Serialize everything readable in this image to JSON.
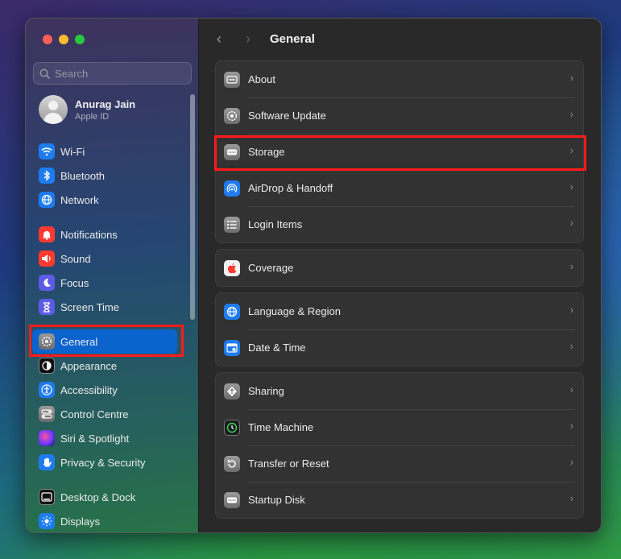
{
  "sidebar": {
    "search_placeholder": "Search",
    "profile": {
      "name": "Anurag Jain",
      "subtitle": "Apple ID"
    },
    "items": [
      {
        "label": "Wi-Fi",
        "icon": "wifi-icon"
      },
      {
        "label": "Bluetooth",
        "icon": "bluetooth-icon"
      },
      {
        "label": "Network",
        "icon": "globe-icon"
      },
      {
        "label": "Notifications",
        "icon": "bell-icon"
      },
      {
        "label": "Sound",
        "icon": "speaker-icon"
      },
      {
        "label": "Focus",
        "icon": "moon-icon"
      },
      {
        "label": "Screen Time",
        "icon": "hourglass-icon"
      },
      {
        "label": "General",
        "icon": "gear-icon",
        "selected": true
      },
      {
        "label": "Appearance",
        "icon": "appearance-icon"
      },
      {
        "label": "Accessibility",
        "icon": "accessibility-icon"
      },
      {
        "label": "Control Centre",
        "icon": "control-centre-icon"
      },
      {
        "label": "Siri & Spotlight",
        "icon": "siri-icon"
      },
      {
        "label": "Privacy & Security",
        "icon": "hand-icon"
      },
      {
        "label": "Desktop & Dock",
        "icon": "dock-icon"
      },
      {
        "label": "Displays",
        "icon": "sun-icon"
      }
    ]
  },
  "header": {
    "title": "General",
    "back": "‹",
    "forward": "›"
  },
  "groups": [
    {
      "rows": [
        {
          "label": "About",
          "icon": "about-icon"
        },
        {
          "label": "Software Update",
          "icon": "software-update-icon"
        },
        {
          "label": "Storage",
          "icon": "storage-icon"
        },
        {
          "label": "AirDrop & Handoff",
          "icon": "airdrop-icon"
        },
        {
          "label": "Login Items",
          "icon": "list-icon"
        }
      ]
    },
    {
      "rows": [
        {
          "label": "Coverage",
          "icon": "apple-icon"
        }
      ]
    },
    {
      "rows": [
        {
          "label": "Language & Region",
          "icon": "globe-icon"
        },
        {
          "label": "Date & Time",
          "icon": "calendar-icon"
        }
      ]
    },
    {
      "rows": [
        {
          "label": "Sharing",
          "icon": "sharing-icon"
        },
        {
          "label": "Time Machine",
          "icon": "time-machine-icon"
        },
        {
          "label": "Transfer or Reset",
          "icon": "reset-icon"
        },
        {
          "label": "Startup Disk",
          "icon": "disk-icon"
        }
      ]
    }
  ],
  "colors": {
    "selected": "#0b63ce",
    "highlight": "#ff1a1a",
    "panel": "#292929"
  }
}
